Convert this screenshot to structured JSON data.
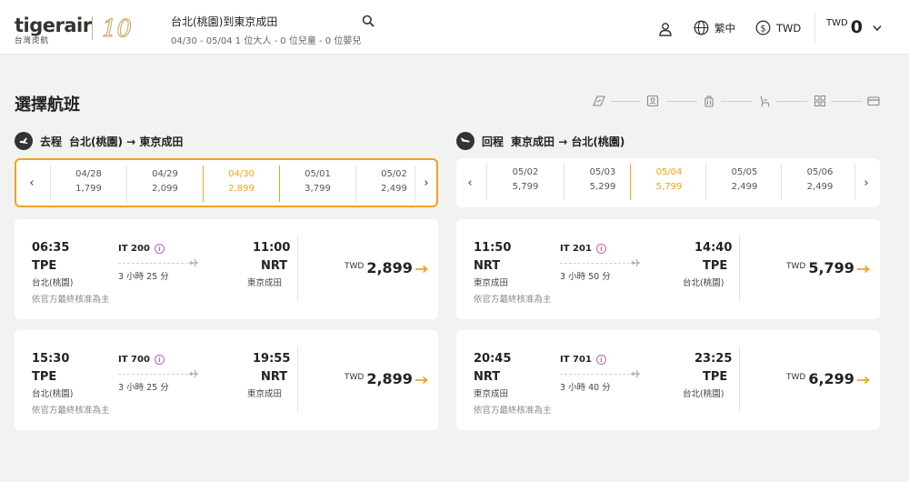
{
  "brand": {
    "logo_text": "tigerair",
    "logo_sub": "台灣虎航",
    "anniversary": "10"
  },
  "header": {
    "route_title": "台北(桃園)到東京成田",
    "route_sub": "04/30 - 05/04   1 位大人 - 0 位兒童 - 0 位嬰兒",
    "language": "繁中",
    "currency": "TWD",
    "total_currency": "TWD",
    "total_amount": "0"
  },
  "page": {
    "title": "選擇航班"
  },
  "steps": [
    "flight-icon",
    "passenger-icon",
    "baggage-icon",
    "seat-icon",
    "addons-icon",
    "payment-icon"
  ],
  "outbound": {
    "label": "去程",
    "route": "台北(桃園) → 東京成田",
    "dates": [
      {
        "date": "04/28",
        "price": "1,799"
      },
      {
        "date": "04/29",
        "price": "2,099"
      },
      {
        "date": "04/30",
        "price": "2,899"
      },
      {
        "date": "05/01",
        "price": "3,799"
      },
      {
        "date": "05/02",
        "price": "2,499"
      }
    ],
    "selected_index": 2,
    "flights": [
      {
        "dep_time": "06:35",
        "dep_code": "TPE",
        "dep_city": "台北(桃園)",
        "flight_no": "IT 200",
        "duration": "3 小時 25 分",
        "arr_time": "11:00",
        "arr_code": "NRT",
        "arr_city": "東京成田",
        "note": "依官方最終核准為主",
        "currency": "TWD",
        "price": "2,899"
      },
      {
        "dep_time": "15:30",
        "dep_code": "TPE",
        "dep_city": "台北(桃園)",
        "flight_no": "IT 700",
        "duration": "3 小時 25 分",
        "arr_time": "19:55",
        "arr_code": "NRT",
        "arr_city": "東京成田",
        "note": "依官方最終核准為主",
        "currency": "TWD",
        "price": "2,899"
      }
    ]
  },
  "inbound": {
    "label": "回程",
    "route": "東京成田 → 台北(桃園)",
    "dates": [
      {
        "date": "05/02",
        "price": "5,799"
      },
      {
        "date": "05/03",
        "price": "5,299"
      },
      {
        "date": "05/04",
        "price": "5,799"
      },
      {
        "date": "05/05",
        "price": "2,499"
      },
      {
        "date": "05/06",
        "price": "2,499"
      }
    ],
    "selected_index": 2,
    "flights": [
      {
        "dep_time": "11:50",
        "dep_code": "NRT",
        "dep_city": "東京成田",
        "flight_no": "IT 201",
        "duration": "3 小時 50 分",
        "arr_time": "14:40",
        "arr_code": "TPE",
        "arr_city": "台北(桃園)",
        "note": "依官方最終核准為主",
        "currency": "TWD",
        "price": "5,799"
      },
      {
        "dep_time": "20:45",
        "dep_code": "NRT",
        "dep_city": "東京成田",
        "flight_no": "IT 701",
        "duration": "3 小時 40 分",
        "arr_time": "23:25",
        "arr_code": "TPE",
        "arr_city": "台北(桃園)",
        "note": "依官方最終核准為主",
        "currency": "TWD",
        "price": "6,299"
      }
    ]
  },
  "colors": {
    "accent": "#f0a21e",
    "info": "#b36bb3",
    "text": "#222222",
    "background": "#f2f2f2"
  }
}
